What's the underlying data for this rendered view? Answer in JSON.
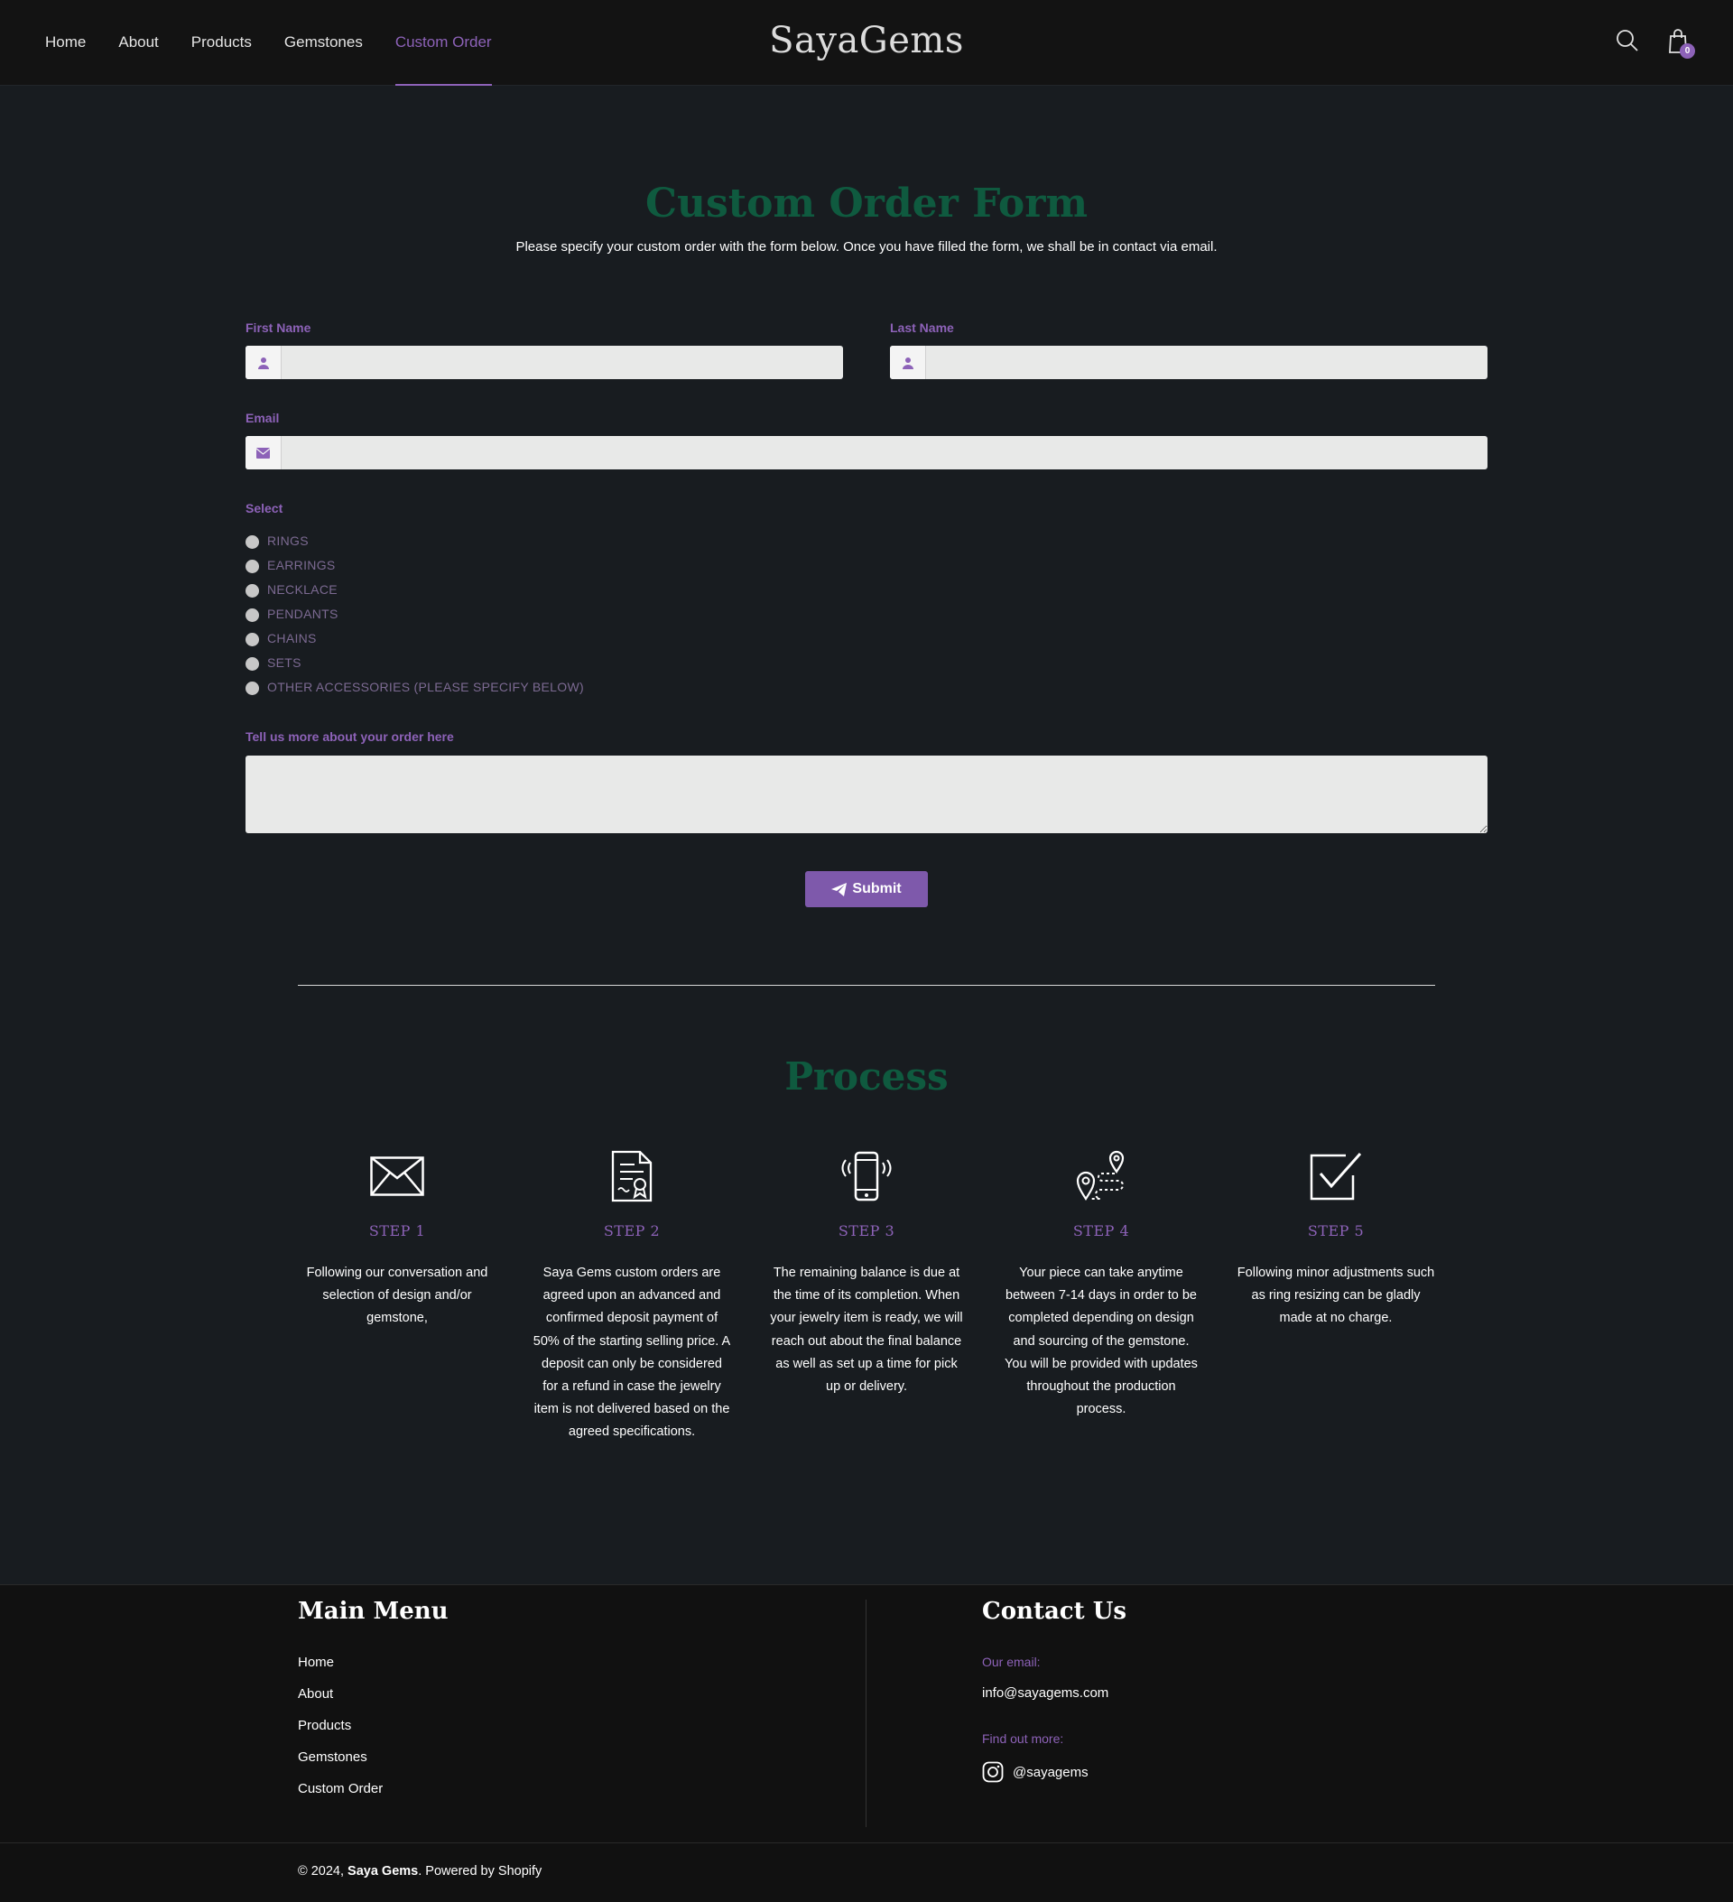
{
  "header": {
    "nav": [
      "Home",
      "About",
      "Products",
      "Gemstones",
      "Custom Order"
    ],
    "active_nav": "Custom Order",
    "logo": "SayaGems",
    "cart_count": "0"
  },
  "form": {
    "title": "Custom Order Form",
    "subtitle": "Please specify your custom order with the form below. Once you have filled the form, we shall be in contact via email.",
    "first_name_label": "First Name",
    "last_name_label": "Last Name",
    "email_label": "Email",
    "select_label": "Select",
    "options": [
      "RINGS",
      "EARRINGS",
      "NECKLACE",
      "PENDANTS",
      "CHAINS",
      "SETS",
      "OTHER ACCESSORIES (PLEASE SPECIFY BELOW)"
    ],
    "details_label": "Tell us more about your order here",
    "submit_label": "Submit"
  },
  "process": {
    "title": "Process",
    "steps": [
      {
        "label": "STEP 1",
        "icon": "envelope-icon",
        "text": "Following our conversation and selection of design and/or gemstone,"
      },
      {
        "label": "STEP 2",
        "icon": "certificate-document-icon",
        "text": "Saya Gems custom orders are agreed upon an advanced and confirmed deposit payment of 50% of the starting selling price. A deposit can only be considered for a refund in case the jewelry item is not delivered based on the agreed specifications."
      },
      {
        "label": "STEP 3",
        "icon": "ringing-phone-icon",
        "text": "The remaining balance is due at the time of its completion. When your jewelry item is ready, we will reach out about the final balance as well as set up a time for pick up or delivery."
      },
      {
        "label": "STEP 4",
        "icon": "route-pin-icon",
        "text": "Your piece can take anytime between 7-14 days in order to be completed depending on design and sourcing of the gemstone. You will be provided with updates throughout the production process."
      },
      {
        "label": "STEP 5",
        "icon": "checkbox-icon",
        "text": "Following minor adjustments such as ring resizing can be gladly made at no charge."
      }
    ]
  },
  "footer": {
    "menu_title": "Main Menu",
    "menu": [
      "Home",
      "About",
      "Products",
      "Gemstones",
      "Custom Order"
    ],
    "contact_title": "Contact Us",
    "email_label": "Our email:",
    "email": "info@sayagems.com",
    "find_label": "Find out more:",
    "instagram": "@sayagems",
    "copyright_prefix": "© 2024,",
    "brand": "Saya Gems",
    "copyright_suffix": ". Powered by Shopify"
  },
  "colors": {
    "accent": "#8d62b8",
    "title_green": "#0f5a3f",
    "background": "#181c20"
  }
}
